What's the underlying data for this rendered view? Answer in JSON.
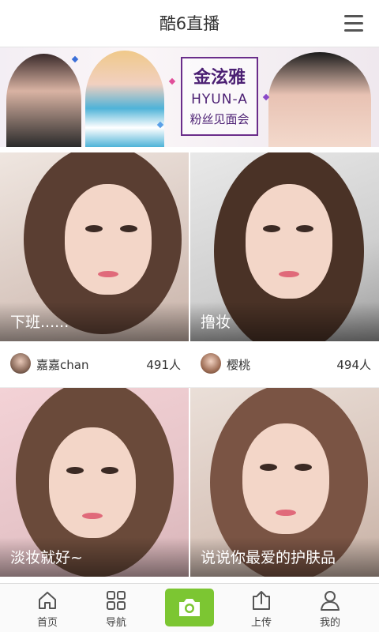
{
  "header": {
    "title": "酷6直播"
  },
  "banner": {
    "line1": "金泫雅",
    "line2": "HYUN-A",
    "line3": "粉丝见面会"
  },
  "streams": [
    {
      "caption": "下班......",
      "user": "嘉嘉chan",
      "viewers": "491人"
    },
    {
      "caption": "撸妆",
      "user": "樱桃",
      "viewers": "494人"
    },
    {
      "caption": "淡妆就好~",
      "user": "",
      "viewers": ""
    },
    {
      "caption": "说说你最爱的护肤品",
      "user": "",
      "viewers": ""
    }
  ],
  "tabbar": {
    "home": "首页",
    "nav": "导航",
    "upload": "上传",
    "mine": "我的"
  },
  "icons": {
    "menu": "menu-icon",
    "home": "home-icon",
    "nav": "grid-icon",
    "camera": "camera-icon",
    "upload": "upload-icon",
    "mine": "user-icon"
  },
  "colors": {
    "accent": "#7cc632",
    "banner_text": "#4b1f73"
  }
}
